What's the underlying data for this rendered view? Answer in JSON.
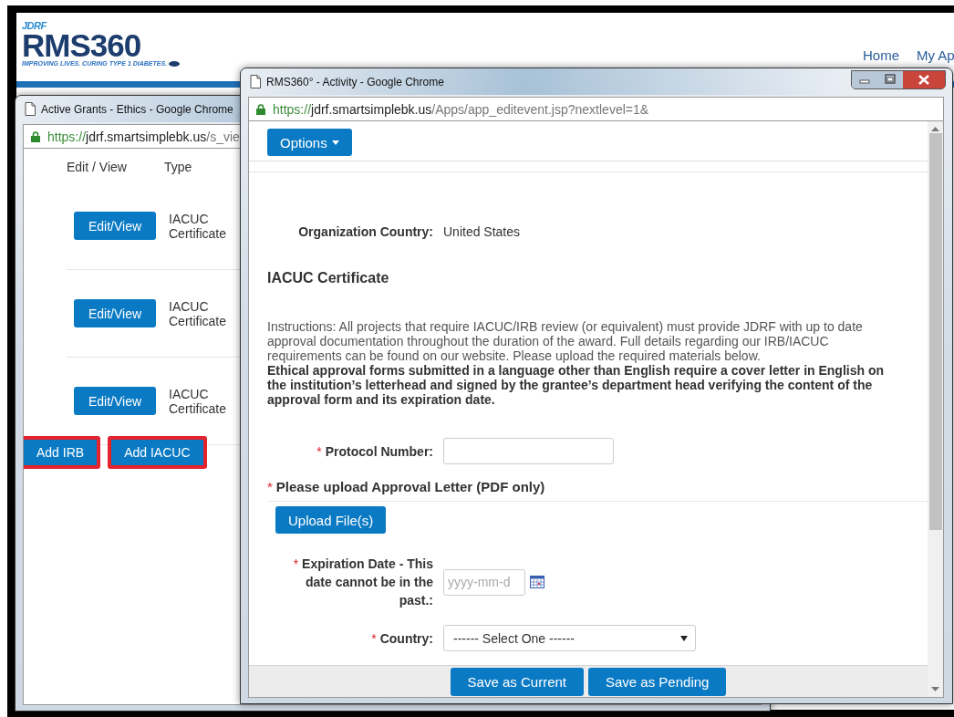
{
  "background_page": {
    "logo": {
      "brand": "JDRF",
      "title": "RMS360",
      "tagline": "IMPROVING LIVES. CURING TYPE 1 DIABETES."
    },
    "nav": [
      "Home",
      "My Ap"
    ]
  },
  "grants_window": {
    "title": "Active Grants - Ethics - Google Chrome",
    "url": {
      "scheme": "https://",
      "host": "jdrf.smartsimplebk.us",
      "path": "/s_vie"
    },
    "columns": [
      "Edit / View",
      "Type"
    ],
    "rows": [
      {
        "button": "Edit/View",
        "type": "IACUC Certificate"
      },
      {
        "button": "Edit/View",
        "type": "IACUC Certificate"
      },
      {
        "button": "Edit/View",
        "type": "IACUC Certificate"
      }
    ],
    "buttons": [
      {
        "label": "Add IRB",
        "highlighted": true
      },
      {
        "label": "Add IACUC",
        "highlighted": true
      }
    ]
  },
  "activity_window": {
    "title": "RMS360° - Activity - Google Chrome",
    "url": {
      "scheme": "https://",
      "host": "jdrf.smartsimplebk.us",
      "path": "/Apps/app_editevent.jsp?nextlevel=1&"
    },
    "options_button": "Options",
    "fields": [
      {
        "kind": "readonly",
        "label": "Organization Country:",
        "value": "United States"
      },
      {
        "kind": "heading",
        "label": "IACUC Certificate"
      },
      {
        "kind": "instructions",
        "text": "Instructions: All projects that require IACUC/IRB review (or equivalent) must provide JDRF with up to date approval documentation throughout the duration of the award. Full details regarding our IRB/IACUC requirements can be found on our website. Please upload the required materials below.\n**Ethical approval forms submitted in a language other than English require a cover letter in English on the institution’s letterhead and signed by the grantee’s department head verifying the content of the approval form and its expiration date.**"
      },
      {
        "kind": "text",
        "mark": "*",
        "label": "Protocol Number:"
      },
      {
        "kind": "upload",
        "mark": "*",
        "label": "Please upload Approval Letter (PDF only)",
        "button": "Upload File(s)"
      },
      {
        "kind": "date",
        "mark": "*",
        "label": "Expiration Date - This date cannot be in the past.:",
        "placeholder": "yyyy-mm-d"
      },
      {
        "kind": "select",
        "mark": "*",
        "label": "Country:",
        "value": "------ Select One ------"
      }
    ],
    "footer_buttons": [
      "Save as Current",
      "Save as Pending"
    ]
  }
}
